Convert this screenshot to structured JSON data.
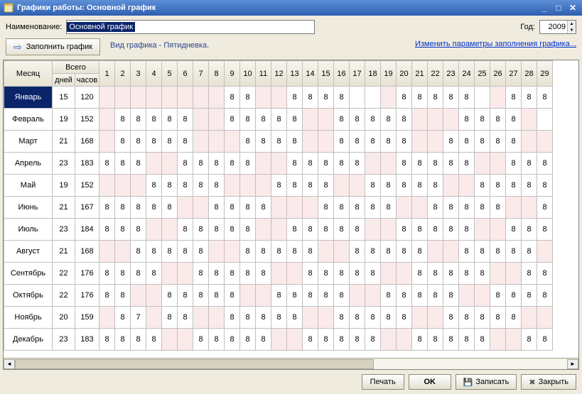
{
  "window": {
    "title": "Графики работы: Основной график"
  },
  "labels": {
    "name": "Наименование:",
    "year": "Год:",
    "fill": "Заполнить график",
    "type": "Вид графика - Пятидневка.",
    "change": "Изменить параметры заполнения графика...",
    "month": "Месяц",
    "total": "Всего",
    "days": "дней",
    "hours": "часов"
  },
  "form": {
    "name": "Основной график",
    "year": "2009"
  },
  "footer": {
    "print": "Печать",
    "ok": "OK",
    "save": "Записать",
    "close": "Закрыть"
  },
  "day_headers": [
    "1",
    "2",
    "3",
    "4",
    "5",
    "6",
    "7",
    "8",
    "9",
    "10",
    "11",
    "12",
    "13",
    "14",
    "15",
    "16",
    "17",
    "18",
    "19",
    "20",
    "21",
    "22",
    "23",
    "24",
    "25",
    "26",
    "27",
    "28",
    "29"
  ],
  "months": [
    {
      "name": "Январь",
      "days": "15",
      "hours": "120",
      "cells": [
        "w",
        "w",
        "w",
        "w",
        "w",
        "w",
        "w",
        "w",
        "8",
        "8",
        "w",
        "w",
        "8",
        "8",
        "8",
        "8",
        "",
        "",
        "w",
        "8",
        "8",
        "8",
        "8",
        "8",
        "",
        "w",
        "8",
        "8",
        "8"
      ]
    },
    {
      "name": "Февраль",
      "days": "19",
      "hours": "152",
      "cells": [
        "w",
        "8",
        "8",
        "8",
        "8",
        "8",
        "w",
        "w",
        "8",
        "8",
        "8",
        "8",
        "8",
        "w",
        "w",
        "8",
        "8",
        "8",
        "8",
        "8",
        "w",
        "w",
        "w",
        "8",
        "8",
        "8",
        "8",
        "w",
        ""
      ]
    },
    {
      "name": "Март",
      "days": "21",
      "hours": "168",
      "cells": [
        "w",
        "8",
        "8",
        "8",
        "8",
        "8",
        "w",
        "w",
        "w",
        "8",
        "8",
        "8",
        "8",
        "w",
        "w",
        "8",
        "8",
        "8",
        "8",
        "8",
        "w",
        "w",
        "8",
        "8",
        "8",
        "8",
        "8",
        "w",
        "w"
      ]
    },
    {
      "name": "Апрель",
      "days": "23",
      "hours": "183",
      "cells": [
        "8",
        "8",
        "8",
        "w",
        "w",
        "8",
        "8",
        "8",
        "8",
        "8",
        "w",
        "w",
        "8",
        "8",
        "8",
        "8",
        "8",
        "w",
        "w",
        "8",
        "8",
        "8",
        "8",
        "8",
        "w",
        "w",
        "8",
        "8",
        "8"
      ]
    },
    {
      "name": "Май",
      "days": "19",
      "hours": "152",
      "cells": [
        "w",
        "w",
        "w",
        "8",
        "8",
        "8",
        "8",
        "8",
        "w",
        "w",
        "w",
        "8",
        "8",
        "8",
        "8",
        "w",
        "w",
        "8",
        "8",
        "8",
        "8",
        "8",
        "w",
        "w",
        "8",
        "8",
        "8",
        "8",
        "8"
      ]
    },
    {
      "name": "Июнь",
      "days": "21",
      "hours": "167",
      "cells": [
        "8",
        "8",
        "8",
        "8",
        "8",
        "w",
        "w",
        "8",
        "8",
        "8",
        "8",
        "w",
        "w",
        "w",
        "8",
        "8",
        "8",
        "8",
        "8",
        "w",
        "w",
        "8",
        "8",
        "8",
        "8",
        "8",
        "w",
        "w",
        "8"
      ]
    },
    {
      "name": "Июль",
      "days": "23",
      "hours": "184",
      "cells": [
        "8",
        "8",
        "8",
        "w",
        "w",
        "8",
        "8",
        "8",
        "8",
        "8",
        "w",
        "w",
        "8",
        "8",
        "8",
        "8",
        "8",
        "w",
        "w",
        "8",
        "8",
        "8",
        "8",
        "8",
        "w",
        "w",
        "8",
        "8",
        "8"
      ]
    },
    {
      "name": "Август",
      "days": "21",
      "hours": "168",
      "cells": [
        "w",
        "w",
        "8",
        "8",
        "8",
        "8",
        "8",
        "w",
        "w",
        "8",
        "8",
        "8",
        "8",
        "8",
        "w",
        "w",
        "8",
        "8",
        "8",
        "8",
        "8",
        "w",
        "w",
        "8",
        "8",
        "8",
        "8",
        "8",
        "w"
      ]
    },
    {
      "name": "Сентябрь",
      "days": "22",
      "hours": "176",
      "cells": [
        "8",
        "8",
        "8",
        "8",
        "w",
        "w",
        "8",
        "8",
        "8",
        "8",
        "8",
        "w",
        "w",
        "8",
        "8",
        "8",
        "8",
        "8",
        "w",
        "w",
        "8",
        "8",
        "8",
        "8",
        "8",
        "w",
        "w",
        "8",
        "8"
      ]
    },
    {
      "name": "Октябрь",
      "days": "22",
      "hours": "176",
      "cells": [
        "8",
        "8",
        "w",
        "w",
        "8",
        "8",
        "8",
        "8",
        "8",
        "w",
        "w",
        "8",
        "8",
        "8",
        "8",
        "8",
        "w",
        "w",
        "8",
        "8",
        "8",
        "8",
        "8",
        "w",
        "w",
        "8",
        "8",
        "8",
        "8"
      ]
    },
    {
      "name": "Ноябрь",
      "days": "20",
      "hours": "159",
      "cells": [
        "w",
        "8",
        "7",
        "w",
        "8",
        "8",
        "w",
        "w",
        "8",
        "8",
        "8",
        "8",
        "8",
        "w",
        "w",
        "8",
        "8",
        "8",
        "8",
        "8",
        "w",
        "w",
        "8",
        "8",
        "8",
        "8",
        "8",
        "w",
        "w"
      ]
    },
    {
      "name": "Декабрь",
      "days": "23",
      "hours": "183",
      "cells": [
        "8",
        "8",
        "8",
        "8",
        "w",
        "w",
        "8",
        "8",
        "8",
        "8",
        "8",
        "w",
        "w",
        "8",
        "8",
        "8",
        "8",
        "8",
        "w",
        "w",
        "8",
        "8",
        "8",
        "8",
        "8",
        "w",
        "w",
        "8",
        "8"
      ]
    }
  ]
}
